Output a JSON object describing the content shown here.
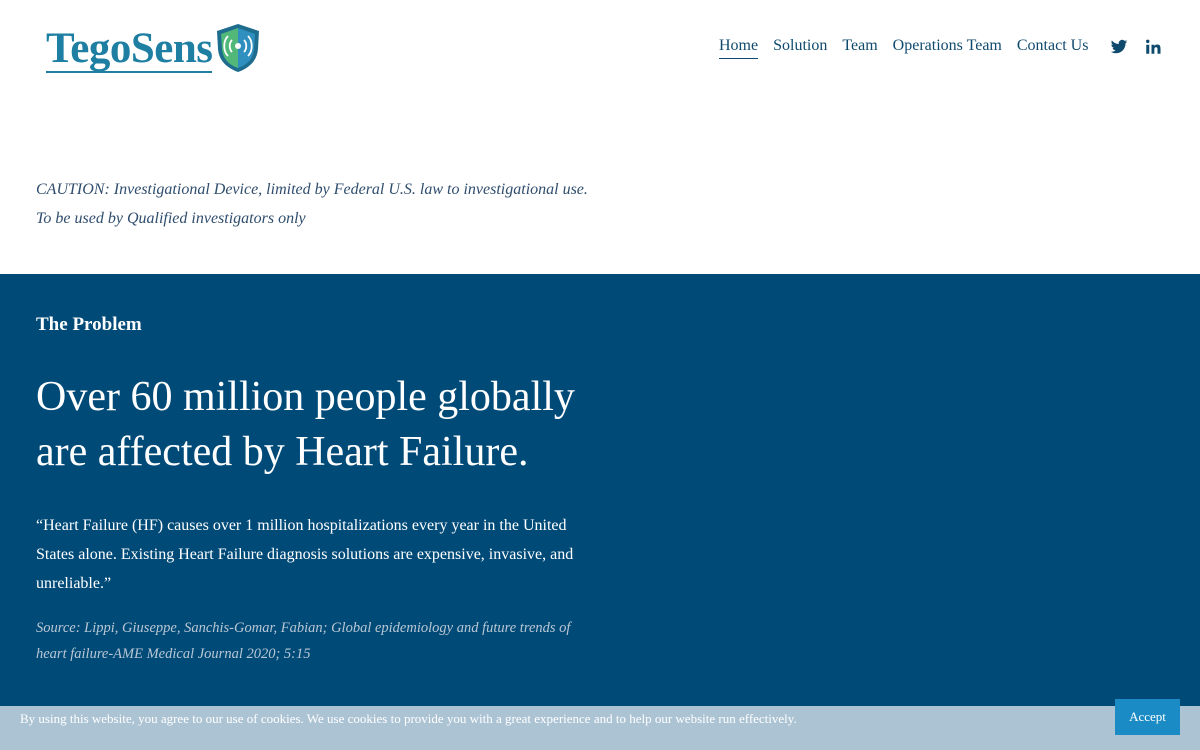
{
  "header": {
    "logo_text": "TegoSens",
    "logo_icon": "shield-signal-icon",
    "nav": [
      {
        "label": "Home",
        "active": true
      },
      {
        "label": "Solution",
        "active": false
      },
      {
        "label": "Team",
        "active": false
      },
      {
        "label": "Operations Team",
        "active": false
      },
      {
        "label": "Contact Us",
        "active": false
      }
    ],
    "social": [
      "twitter-icon",
      "linkedin-icon"
    ]
  },
  "caution": {
    "text": "CAUTION: Investigational Device, limited by Federal U.S. law to investigational use. To be used by Qualified investigators only"
  },
  "problem": {
    "label_prefix": "The",
    "label_strong": "Problem",
    "headline": "Over 60 million people globally are affected by Heart Failure.",
    "quote": "“Heart Failure (HF) causes over 1 million hospitalizations every year in the United States alone. Existing Heart Failure diagnosis solutions are expensive, invasive, and unreliable.”",
    "source": "Source: Lippi, Giuseppe, Sanchis-Gomar, Fabian; Global epidemiology and future trends of heart failure-AME Medical Journal 2020; 5:15"
  },
  "cookie": {
    "text": "By using this website, you agree to our use of cookies. We use cookies to provide you with a great experience and to help our website run effectively.",
    "accept_label": "Accept"
  },
  "colors": {
    "brand_blue": "#1e7fa3",
    "nav_text": "#0f4a6e",
    "section_bg": "#004a78",
    "accept_button": "#1a8bc4"
  }
}
